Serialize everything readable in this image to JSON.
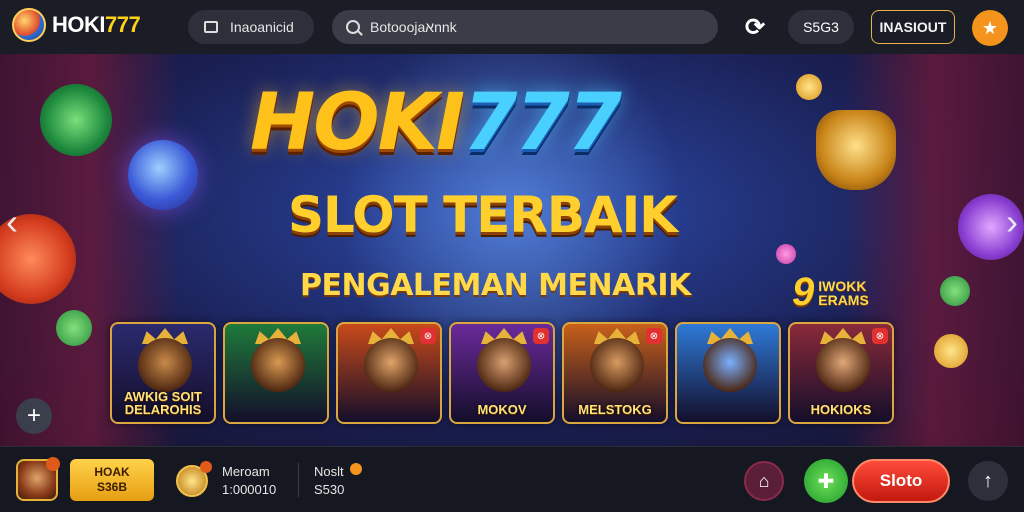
{
  "topbar": {
    "logo_white": "HOKI",
    "logo_yellow": "777",
    "menu_label": "Inaoanicid",
    "search_placeholder": "Botooojaאnnk",
    "value_label": "S5G3",
    "login_label": "INASIOUT"
  },
  "hero": {
    "title_part1": "HOKI",
    "title_part2": "777",
    "subtitle": "SLOT TERBAIK",
    "tagline": "PENGALEMAN MENARIK",
    "badge_number": "9",
    "badge_line1": "IWOKK",
    "badge_line2": "ERAMS",
    "cards": [
      {
        "label": "AWKIG SOIT\nDELAROHIS",
        "bg": "#2b2a6e",
        "face": "#c98a4a",
        "corner": ""
      },
      {
        "label": "",
        "bg": "#1f7a3a",
        "face": "#d89a52",
        "corner": ""
      },
      {
        "label": "",
        "bg": "#c84a1a",
        "face": "#e0a46a",
        "corner": "⊗"
      },
      {
        "label": "MOKOV",
        "bg": "#6a2a9a",
        "face": "#d8a070",
        "corner": "⊗"
      },
      {
        "label": "MELSTOKG",
        "bg": "#c8601a",
        "face": "#d89a60",
        "corner": "⊗"
      },
      {
        "label": "",
        "bg": "#2f7ad8",
        "face": "#7ab0ff",
        "corner": ""
      },
      {
        "label": "HOKIOKS",
        "bg": "#8a2a3a",
        "face": "#e0a878",
        "corner": "⊗"
      }
    ]
  },
  "bottombar": {
    "coin_line1": "HOAK",
    "coin_line2": "S36B",
    "stat1_label": "Meroam",
    "stat1_value": "1:000010",
    "stat2_label": "Noslt",
    "stat2_value": "S530",
    "slot_label": "Sloto"
  },
  "colors": {
    "accent": "#ffd21a",
    "login_border": "#e7b24a",
    "star": "#f4941c",
    "slot_red": "#e0251a",
    "game_green": "#3ec23a"
  },
  "icons": {
    "menu": "window-icon",
    "search": "search-icon",
    "sync": "sync-icon",
    "star": "star-icon",
    "plus": "plus-icon",
    "home": "home-icon",
    "game": "gamepad-icon",
    "up": "arrow-up-icon"
  }
}
